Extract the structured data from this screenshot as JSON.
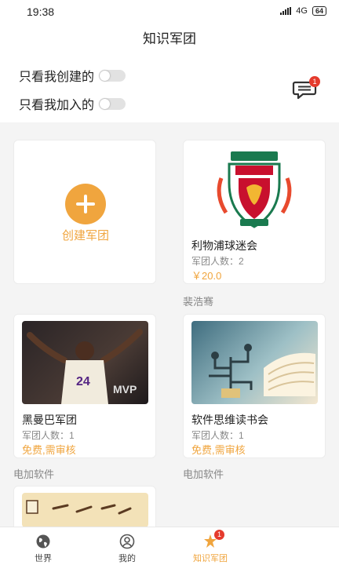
{
  "status_bar": {
    "time": "19:38",
    "network": "4G",
    "battery": "64"
  },
  "header": {
    "title": "知识军团"
  },
  "filters": [
    {
      "label": "只看我创建的",
      "enabled": false
    },
    {
      "label": "只看我加入的",
      "enabled": false
    }
  ],
  "messages": {
    "badge": "1",
    "icon": "message-icon"
  },
  "create": {
    "label": "创建军团",
    "icon": "plus-icon"
  },
  "groups": [
    {
      "title": "利物浦球迷会",
      "count": "军团人数：2",
      "price": "￥20.0",
      "owner": "裴浩骞",
      "image": "liverpool-crest"
    },
    {
      "title": "黑曼巴军团",
      "count": "军团人数：1",
      "price": "免费,需审核",
      "owner": "电加软件",
      "image": "kobe-photo"
    },
    {
      "title": "软件思维读书会",
      "count": "军团人数：1",
      "price": "免费,需审核",
      "owner": "电加软件",
      "image": "books-illustration"
    }
  ],
  "bottom_nav": [
    {
      "label": "世界",
      "icon": "globe-icon"
    },
    {
      "label": "我的",
      "icon": "person-icon"
    },
    {
      "label": "知识军团",
      "icon": "army-icon",
      "badge": "1"
    }
  ],
  "colors": {
    "accent": "#f0a53e",
    "badge": "#e53b2d"
  }
}
